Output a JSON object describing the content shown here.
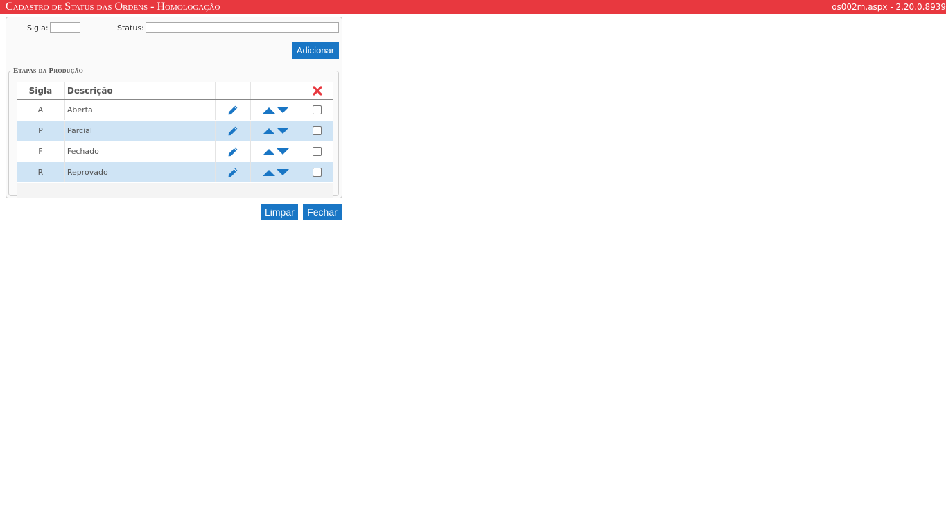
{
  "header": {
    "title": "Cadastro de Status das Ordens  - Homologação",
    "version": "os002m.aspx - 2.20.0.8939"
  },
  "form": {
    "sigla_label": "Sigla:",
    "sigla_value": "",
    "status_label": "Status:",
    "status_value": "",
    "add_label": "Adicionar"
  },
  "grid": {
    "legend": "Etapas da Produção",
    "col_sigla": "Sigla",
    "col_descricao": "Descrição",
    "rows": [
      {
        "sigla": "A",
        "descricao": "Aberta"
      },
      {
        "sigla": "P",
        "descricao": "Parcial"
      },
      {
        "sigla": "F",
        "descricao": "Fechado"
      },
      {
        "sigla": "R",
        "descricao": "Reprovado"
      }
    ]
  },
  "actions": {
    "limpar_label": "Limpar",
    "fechar_label": "Fechar"
  },
  "colors": {
    "header_bg": "#e8383f",
    "button_bg": "#1976c5",
    "icon_blue": "#1976c5",
    "delete_red": "#e8383f",
    "alt_row": "#cfe4f5"
  },
  "icons": {
    "edit": "pencil-icon",
    "move_up": "arrow-up-icon",
    "move_down": "arrow-down-icon",
    "delete_all": "delete-x-icon"
  }
}
